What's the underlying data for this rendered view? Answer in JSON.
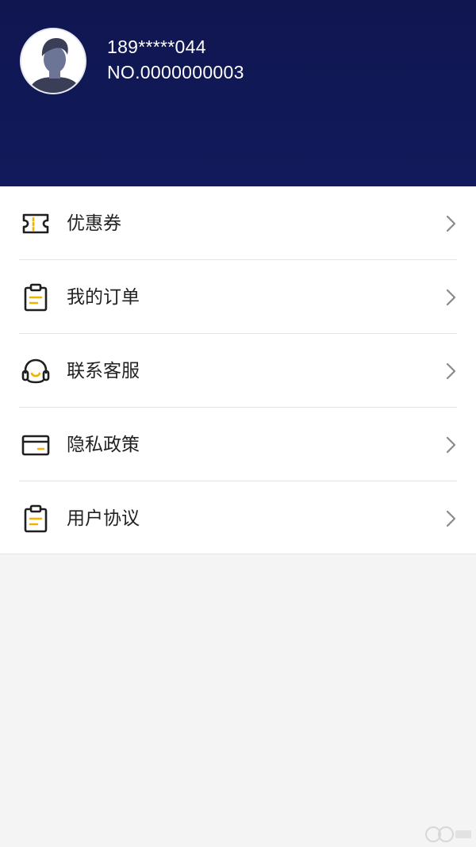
{
  "header": {
    "phone": "189*****044",
    "user_no": "NO.0000000003",
    "background_color": "#0f1650",
    "avatar_icon": "user-avatar-icon"
  },
  "menu": {
    "accent_color": "#f2b200",
    "items": [
      {
        "label": "优惠券",
        "icon": "coupon-icon"
      },
      {
        "label": "我的订单",
        "icon": "clipboard-icon"
      },
      {
        "label": "联系客服",
        "icon": "headset-icon"
      },
      {
        "label": "隐私政策",
        "icon": "card-icon"
      },
      {
        "label": "用户协议",
        "icon": "clipboard-icon"
      }
    ]
  },
  "watermark": {
    "icon": "pc6-logo"
  }
}
